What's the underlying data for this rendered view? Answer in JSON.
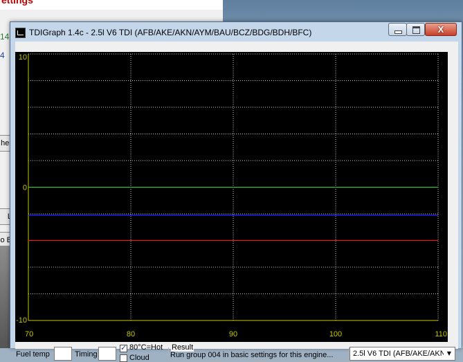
{
  "background": {
    "title_fragment": "ettings",
    "numbers": [
      "14",
      "4"
    ],
    "buttons": [
      "her",
      "L",
      "o B"
    ]
  },
  "window": {
    "title": "TDIGraph 1.4c - 2.5l V6 TDI (AFB/AKE/AKN/AYM/BAU/BCZ/BDG/BDH/BFC)",
    "close_glyph": "X"
  },
  "controls": {
    "fuel_temp_label": "Fuel temp",
    "fuel_temp_value": "",
    "timing_label": "Timing",
    "timing_value": "",
    "hot_label": "80°C=Hot",
    "hot_checked": true,
    "cloud_label": "Cloud",
    "cloud_checked": false,
    "result_label": "Result",
    "result_text": "Run group 004 in basic settings for this engine...",
    "engine_selected": "2.5l V6 TDI (AFB/AKE/AKN"
  },
  "chart_data": {
    "type": "line",
    "xlim": [
      70,
      110
    ],
    "ylim": [
      -10,
      10
    ],
    "x_ticks": [
      "70",
      "80",
      "90",
      "100",
      "110"
    ],
    "y_ticks": [
      "10",
      "0",
      "-10"
    ],
    "grid": true,
    "background": "#000000",
    "axis_color": "#c8c800",
    "grid_color": "#c8c8c8",
    "series": [
      {
        "color": "#3cbf3c",
        "values": [
          [
            70,
            0
          ],
          [
            110,
            0
          ]
        ]
      },
      {
        "color": "#2020ff",
        "values": [
          [
            70,
            -2.1
          ],
          [
            110,
            -2.1
          ]
        ]
      },
      {
        "color": "#e02020",
        "values": [
          [
            70,
            -4.0
          ],
          [
            110,
            -4.0
          ]
        ]
      }
    ]
  }
}
